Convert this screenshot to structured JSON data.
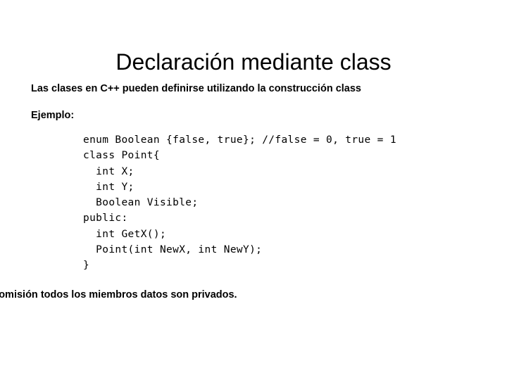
{
  "slide": {
    "title": "Declaración mediante class",
    "intro_text": "Las clases en C++ pueden definirse utilizando la construcción class",
    "example_label": "Ejemplo:",
    "code_lines": [
      "enum Boolean {false, true}; //false = 0, true = 1",
      "class Point{",
      "  int X;",
      "  int Y;",
      "  Boolean Visible;",
      "public:",
      "  int GetX();",
      "  Point(int NewX, int NewY);",
      "}"
    ],
    "closing_text": "Por omisión todos los miembros datos son privados.",
    "colors": {
      "background": "#ffffff",
      "text": "#000000"
    }
  }
}
